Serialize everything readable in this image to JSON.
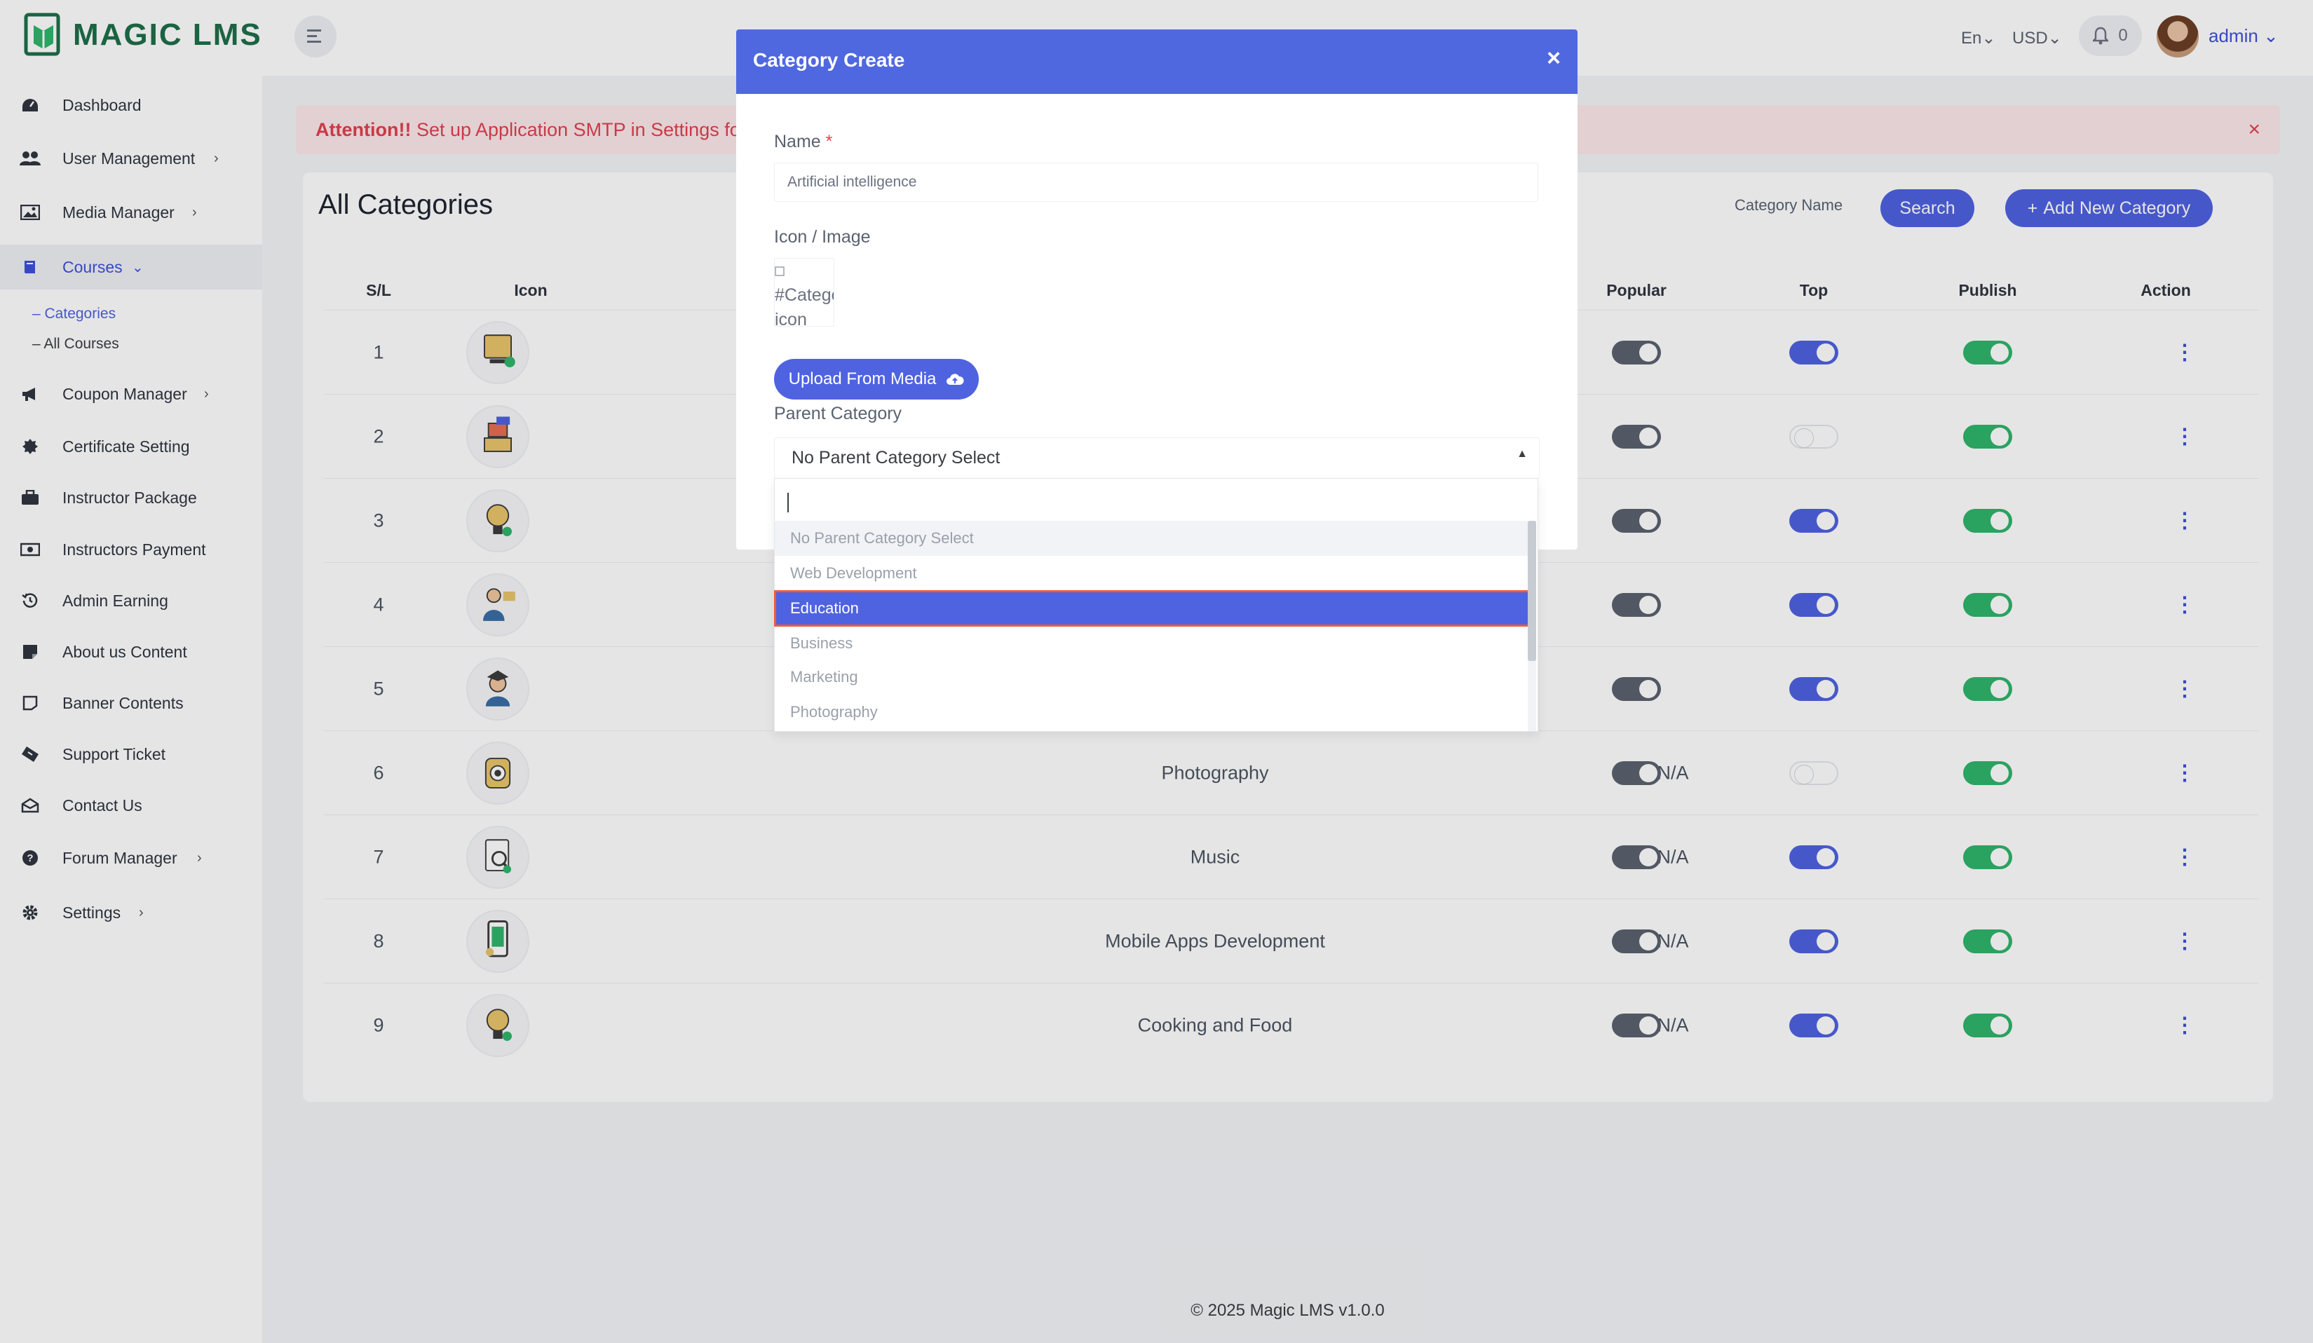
{
  "app": {
    "brand": "MAGIC LMS"
  },
  "header": {
    "language": "En",
    "currency": "USD",
    "notification_count": "0",
    "user_name": "admin"
  },
  "sidebar": {
    "items": [
      {
        "label": "Dashboard",
        "icon": "dashboard-icon"
      },
      {
        "label": "User Management",
        "icon": "users-icon"
      },
      {
        "label": "Media Manager",
        "icon": "image-icon"
      },
      {
        "label": "Courses",
        "icon": "book-icon"
      },
      {
        "label": "Coupon Manager",
        "icon": "megaphone-icon"
      },
      {
        "label": "Certificate Setting",
        "icon": "badge-icon"
      },
      {
        "label": "Instructor Package",
        "icon": "briefcase-icon"
      },
      {
        "label": "Instructors Payment",
        "icon": "money-icon"
      },
      {
        "label": "Admin Earning",
        "icon": "history-icon"
      },
      {
        "label": "About us Content",
        "icon": "note-icon"
      },
      {
        "label": "Banner Contents",
        "icon": "banner-icon"
      },
      {
        "label": "Support Ticket",
        "icon": "ticket-icon"
      },
      {
        "label": "Contact Us",
        "icon": "envelope-icon"
      },
      {
        "label": "Forum Manager",
        "icon": "question-icon"
      },
      {
        "label": "Settings",
        "icon": "gear-icon"
      }
    ],
    "courses_sub": [
      {
        "label": "– Categories"
      },
      {
        "label": "– All Courses"
      }
    ]
  },
  "alert": {
    "strong": "Attention!!",
    "text": " Set up Application SMTP in Settings fo"
  },
  "main": {
    "title": "All Categories",
    "search_label": "Category Name",
    "search_button": "Search",
    "add_button": "Add New Category",
    "columns": [
      "S/L",
      "Icon",
      "Popular",
      "Top",
      "Publish",
      "Action"
    ],
    "rows": [
      {
        "sl": "1",
        "name": "",
        "parent": "",
        "popular": true,
        "top": true,
        "publish": true
      },
      {
        "sl": "2",
        "name": "",
        "parent": "",
        "popular": true,
        "top": false,
        "publish": true
      },
      {
        "sl": "3",
        "name": "",
        "parent": "",
        "popular": true,
        "top": true,
        "publish": true
      },
      {
        "sl": "4",
        "name": "",
        "parent": "",
        "popular": true,
        "top": true,
        "publish": true
      },
      {
        "sl": "5",
        "name": "",
        "parent": "",
        "popular": true,
        "top": true,
        "publish": true
      },
      {
        "sl": "6",
        "name": "Photography",
        "parent": "N/A",
        "popular": true,
        "top": false,
        "publish": true
      },
      {
        "sl": "7",
        "name": "Music",
        "parent": "N/A",
        "popular": true,
        "top": true,
        "publish": true
      },
      {
        "sl": "8",
        "name": "Mobile Apps Development",
        "parent": "N/A",
        "popular": true,
        "top": true,
        "publish": true
      },
      {
        "sl": "9",
        "name": "Cooking and Food",
        "parent": "N/A",
        "popular": true,
        "top": true,
        "publish": true
      }
    ]
  },
  "footer": {
    "text": "© 2025 Magic LMS v1.0.0"
  },
  "modal": {
    "title": "Category Create",
    "name_label": "Name",
    "required_mark": "*",
    "name_value": "Artificial intelligence",
    "icon_label": "Icon / Image",
    "image_alt": "#Category icon",
    "upload_button": "Upload From Media",
    "parent_label": "Parent Category",
    "parent_selected": "No Parent Category Select"
  },
  "dropdown": {
    "search_value": "",
    "options": [
      {
        "label": "No Parent Category Select"
      },
      {
        "label": "Web Development"
      },
      {
        "label": "Education"
      },
      {
        "label": "Business"
      },
      {
        "label": "Marketing"
      },
      {
        "label": "Photography"
      }
    ],
    "highlighted": "Education"
  },
  "colors": {
    "accent": "#4f63e0",
    "modal_header": "#4f68e0",
    "toggle_popular": "#5b6270",
    "toggle_publish": "#2fb56b",
    "alert_text": "#e0414f",
    "brand_green": "#1f6f4a"
  }
}
